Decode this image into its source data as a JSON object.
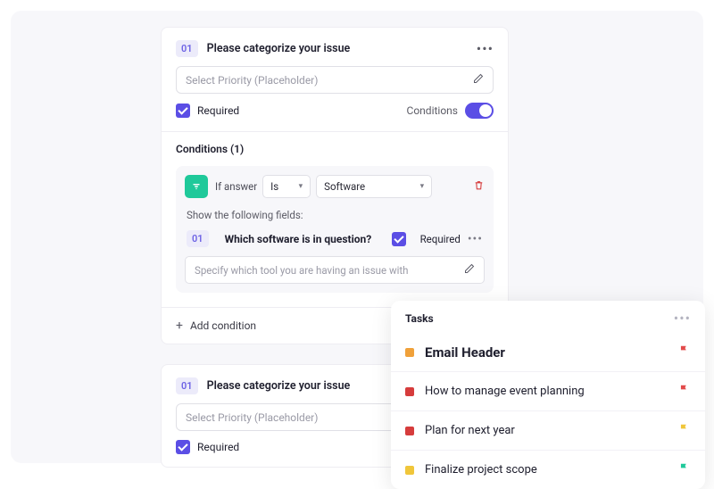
{
  "field1": {
    "num": "01",
    "title": "Please categorize your issue",
    "placeholder": "Select Priority (Placeholder)",
    "required_label": "Required",
    "conditions_label": "Conditions",
    "conditions_title": "Conditions (1)",
    "if_answer": "If answer",
    "operator": "Is",
    "value": "Software",
    "show_text": "Show the following fields:",
    "sub_num": "01",
    "sub_title": "Which software is in question?",
    "sub_required_label": "Required",
    "sub_placeholder": "Specify which tool you are having an issue with",
    "add_condition": "Add condition"
  },
  "field2": {
    "num": "01",
    "title": "Please categorize your issue",
    "placeholder": "Select Priority (Placeholder)",
    "required_label": "Required"
  },
  "tasks": {
    "title": "Tasks",
    "items": [
      {
        "label": "Email Header",
        "color": "#f0a13a",
        "flag": "#e24a4a"
      },
      {
        "label": "How to manage event planning",
        "color": "#d63c3c",
        "flag": "#e24a4a"
      },
      {
        "label": "Plan for next year",
        "color": "#d63c3c",
        "flag": "#f0c63a"
      },
      {
        "label": "Finalize project scope",
        "color": "#f0c63a",
        "flag": "#1fc99a"
      }
    ]
  }
}
